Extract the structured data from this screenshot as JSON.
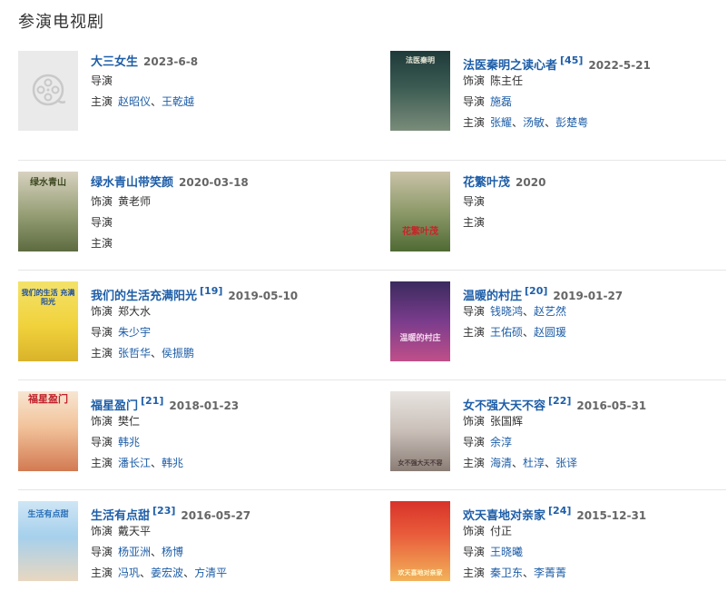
{
  "section": {
    "title": "参演电视剧"
  },
  "labels": {
    "role": "饰演",
    "director": "导演",
    "cast": "主演"
  },
  "sep": "、",
  "items": [
    {
      "title": "大三女生",
      "ref": "",
      "date": "2023-6-8",
      "poster_text": "",
      "directors": [],
      "cast": [
        "赵昭仪",
        "王乾越"
      ]
    },
    {
      "title": "法医秦明之读心者",
      "ref": "[45]",
      "date": "2022-5-21",
      "poster_text": "法医秦明",
      "role": "陈主任",
      "directors": [
        "施磊"
      ],
      "cast": [
        "张耀",
        "汤敏",
        "彭楚粤"
      ]
    },
    {
      "title": "绿水青山带笑颜",
      "ref": "",
      "date": "2020-03-18",
      "poster_text": "绿水青山",
      "role": "黄老师",
      "directors": [],
      "cast": []
    },
    {
      "title": "花繁叶茂",
      "ref": "",
      "date": "2020",
      "poster_text": "花繁叶茂",
      "directors": [],
      "cast": []
    },
    {
      "title": "我们的生活充满阳光",
      "ref": "[19]",
      "date": "2019-05-10",
      "poster_text": "我们的生活 充满阳光",
      "role": "郑大水",
      "directors": [
        "朱少宇"
      ],
      "cast": [
        "张哲华",
        "侯振鹏"
      ]
    },
    {
      "title": "温暖的村庄",
      "ref": "[20]",
      "date": "2019-01-27",
      "poster_text": "温暖的村庄",
      "directors": [
        "钱晓鸿",
        "赵艺然"
      ],
      "cast": [
        "王佑硕",
        "赵圆瑗"
      ]
    },
    {
      "title": "福星盈门",
      "ref": "[21]",
      "date": "2018-01-23",
      "poster_text": "福星盈门",
      "role": "樊仁",
      "directors": [
        "韩兆"
      ],
      "cast": [
        "潘长江",
        "韩兆"
      ]
    },
    {
      "title": "女不强大天不容",
      "ref": "[22]",
      "date": "2016-05-31",
      "poster_text": "女不强大天不容",
      "role": "张国辉",
      "directors": [
        "余淳"
      ],
      "cast": [
        "海清",
        "杜淳",
        "张译"
      ]
    },
    {
      "title": "生活有点甜",
      "ref": "[23]",
      "date": "2016-05-27",
      "poster_text": "生活有点甜",
      "role": "戴天平",
      "directors": [
        "杨亚洲",
        "杨博"
      ],
      "cast": [
        "冯巩",
        "姜宏波",
        "方清平"
      ]
    },
    {
      "title": "欢天喜地对亲家",
      "ref": "[24]",
      "date": "2015-12-31",
      "poster_text": "欢天喜地对亲家",
      "role": "付正",
      "directors": [
        "王晓曦"
      ],
      "cast": [
        "秦卫东",
        "李菁菁"
      ]
    }
  ],
  "colors": {
    "link": "#1e5ea8",
    "date": "#666666",
    "divider": "#e6e6e6"
  },
  "icons": {
    "placeholder": "film-reel-icon"
  }
}
